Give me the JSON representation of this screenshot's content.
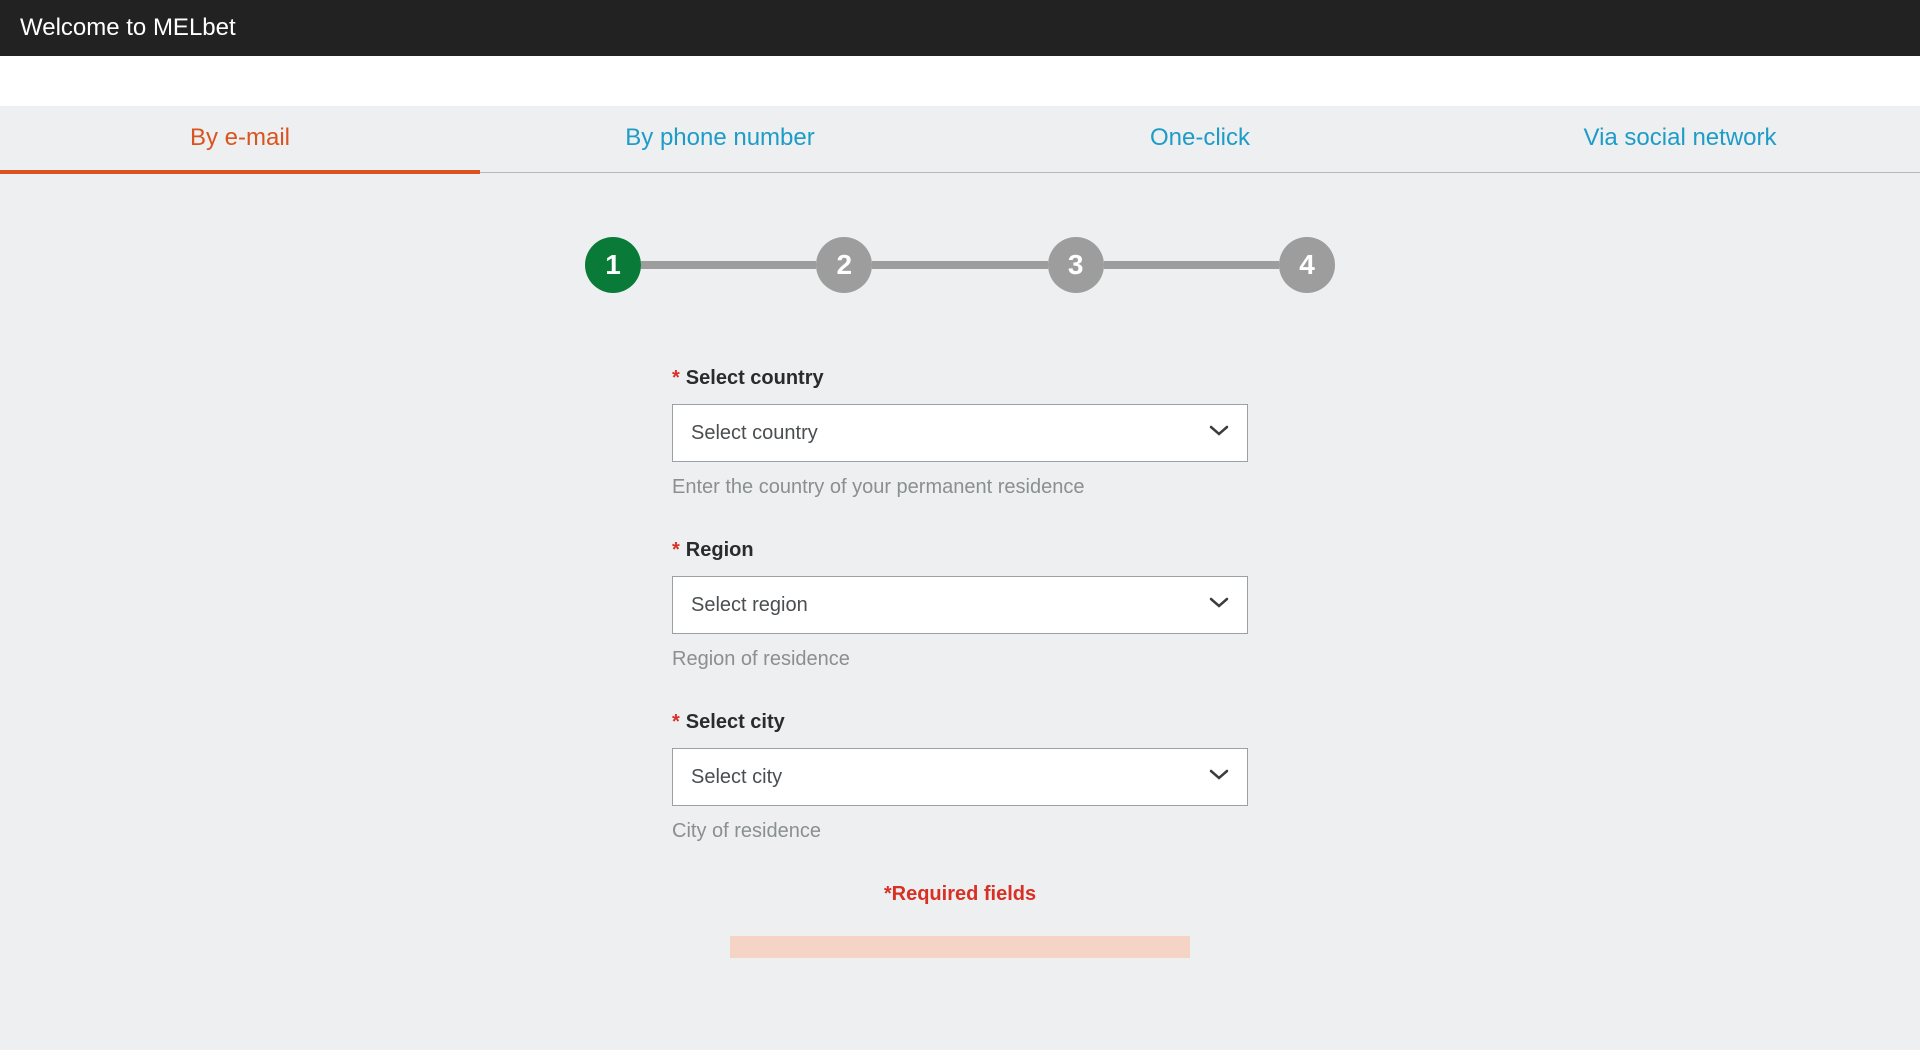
{
  "header": {
    "title": "Welcome to MELbet"
  },
  "tabs": [
    {
      "label": "By e-mail",
      "active": true
    },
    {
      "label": "By phone number",
      "active": false
    },
    {
      "label": "One-click",
      "active": false
    },
    {
      "label": "Via social network",
      "active": false
    }
  ],
  "stepper": {
    "steps": [
      "1",
      "2",
      "3",
      "4"
    ],
    "active_index": 0
  },
  "form": {
    "fields": [
      {
        "label": "Select country",
        "placeholder": "Select country",
        "hint": "Enter the country of your permanent residence",
        "required": true
      },
      {
        "label": "Region",
        "placeholder": "Select region",
        "hint": "Region of residence",
        "required": true
      },
      {
        "label": "Select city",
        "placeholder": "Select city",
        "hint": "City of residence",
        "required": true
      }
    ],
    "required_note": "*Required fields"
  }
}
